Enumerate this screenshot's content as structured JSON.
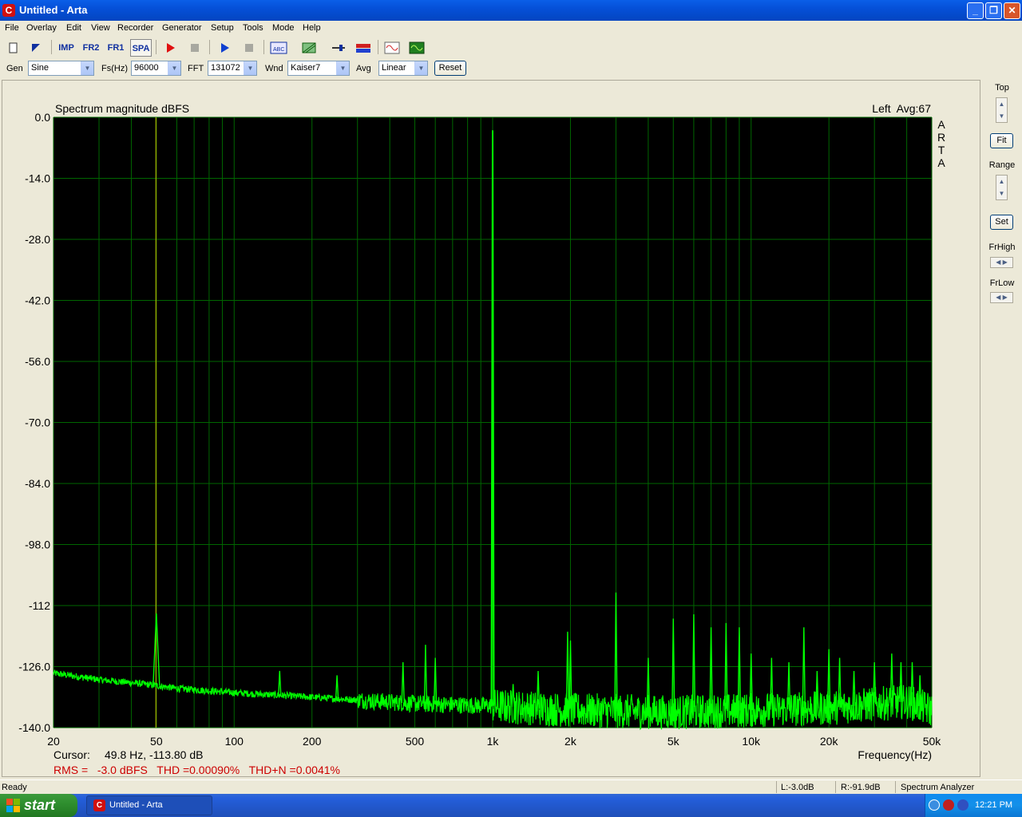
{
  "window": {
    "title": "Untitled - Arta",
    "icon": "arta-c-icon"
  },
  "menu": [
    "File",
    "Overlay",
    "Edit",
    "View",
    "Recorder",
    "Generator",
    "Setup",
    "Tools",
    "Mode",
    "Help"
  ],
  "toolbar": {
    "imp": "IMP",
    "fr2": "FR2",
    "fr1": "FR1",
    "spa": "SPA"
  },
  "options": {
    "gen_label": "Gen",
    "gen_value": "Sine",
    "fs_label": "Fs(Hz)",
    "fs_value": "96000",
    "fft_label": "FFT",
    "fft_value": "131072",
    "wnd_label": "Wnd",
    "wnd_value": "Kaiser7",
    "avg_label": "Avg",
    "avg_value": "Linear",
    "reset_label": "Reset"
  },
  "plot": {
    "title": "Spectrum magnitude dBFS",
    "channel_info": "Left  Avg:67",
    "watermark": [
      "A",
      "R",
      "T",
      "A"
    ],
    "xlabel": "Frequency(Hz)",
    "cursor_label": "Cursor:",
    "cursor_value": "49.8 Hz, -113.80 dB",
    "stats": "RMS =   -3.0 dBFS   THD =0.00090%   THD+N =0.0041%",
    "colors": {
      "background": "#000000",
      "grid": "#006600",
      "trace": "#00ff00",
      "cursor": "#c8c800",
      "stats_text": "#cc0000"
    }
  },
  "chart_data": {
    "type": "line",
    "title": "Spectrum magnitude dBFS",
    "xlabel": "Frequency(Hz)",
    "ylabel": "",
    "xscale": "log",
    "xlim": [
      20,
      50000
    ],
    "ylim": [
      -140,
      0
    ],
    "yticks": [
      "0.0",
      "-14.0",
      "-28.0",
      "-42.0",
      "-56.0",
      "-70.0",
      "-84.0",
      "-98.0",
      "-112",
      "-126.0",
      "-140.0"
    ],
    "yticks_values": [
      0,
      -14,
      -28,
      -42,
      -56,
      -70,
      -84,
      -98,
      -112,
      -126,
      -140
    ],
    "xticks": [
      "20",
      "50",
      "100",
      "200",
      "500",
      "1k",
      "2k",
      "5k",
      "10k",
      "20k",
      "50k"
    ],
    "xticks_values": [
      20,
      50,
      100,
      200,
      500,
      1000,
      2000,
      5000,
      10000,
      20000,
      50000
    ],
    "cursor_x": 49.8,
    "noise_floor": [
      [
        20,
        -127.5
      ],
      [
        30,
        -129
      ],
      [
        45,
        -130
      ],
      [
        60,
        -131
      ],
      [
        100,
        -132
      ],
      [
        200,
        -133
      ],
      [
        500,
        -134.5
      ],
      [
        1000,
        -135
      ],
      [
        2000,
        -136
      ],
      [
        5000,
        -136.5
      ],
      [
        10000,
        -136
      ],
      [
        20000,
        -135.5
      ],
      [
        40000,
        -134
      ],
      [
        50000,
        -136
      ]
    ],
    "peaks": [
      {
        "f": 50,
        "db": -113.8
      },
      {
        "f": 150,
        "db": -127
      },
      {
        "f": 250,
        "db": -128
      },
      {
        "f": 450,
        "db": -125
      },
      {
        "f": 550,
        "db": -121
      },
      {
        "f": 600,
        "db": -124
      },
      {
        "f": 1000,
        "db": -3
      },
      {
        "f": 1000.5,
        "db": -50
      },
      {
        "f": 1200,
        "db": -130
      },
      {
        "f": 1500,
        "db": -127
      },
      {
        "f": 1950,
        "db": -118
      },
      {
        "f": 2000,
        "db": -120
      },
      {
        "f": 3000,
        "db": -109
      },
      {
        "f": 4000,
        "db": -124
      },
      {
        "f": 5000,
        "db": -115
      },
      {
        "f": 6000,
        "db": -114
      },
      {
        "f": 7000,
        "db": -117
      },
      {
        "f": 8000,
        "db": -116
      },
      {
        "f": 9000,
        "db": -117
      },
      {
        "f": 10000,
        "db": -123
      },
      {
        "f": 12000,
        "db": -124
      },
      {
        "f": 14000,
        "db": -125
      },
      {
        "f": 16000,
        "db": -117
      },
      {
        "f": 18000,
        "db": -127
      },
      {
        "f": 20000,
        "db": -122
      },
      {
        "f": 22000,
        "db": -124
      },
      {
        "f": 25000,
        "db": -127
      },
      {
        "f": 30000,
        "db": -125
      },
      {
        "f": 35000,
        "db": -123
      },
      {
        "f": 38000,
        "db": -125
      },
      {
        "f": 42000,
        "db": -125
      },
      {
        "f": 45000,
        "db": -128
      }
    ]
  },
  "right_panel": {
    "top_label": "Top",
    "fit_label": "Fit",
    "range_label": "Range",
    "set_label": "Set",
    "frhigh_label": "FrHigh",
    "frlow_label": "FrLow"
  },
  "status": {
    "ready": "Ready",
    "left_level": "L:-3.0dB",
    "right_level": "R:-91.9dB",
    "mode": "Spectrum Analyzer"
  },
  "taskbar": {
    "start_label": "start",
    "task_label": "Untitled - Arta",
    "clock": "12:21 PM"
  }
}
